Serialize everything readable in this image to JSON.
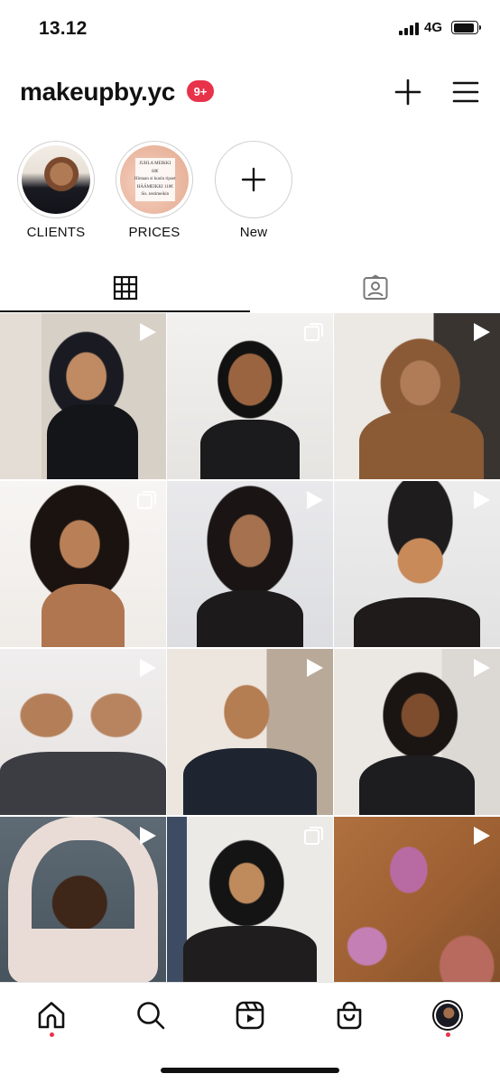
{
  "status": {
    "time": "13.12",
    "network": "4G",
    "battery_level": 0.9
  },
  "profile": {
    "username": "makeupby.yc",
    "notification_badge": "9+"
  },
  "highlights": [
    {
      "label": "CLIENTS",
      "image": "client-portrait"
    },
    {
      "label": "PRICES",
      "image": "price-list",
      "card_lines": [
        "JUHLA MEIKKI",
        "60€",
        "Hintaan si kuulu ripset",
        "HÄÄMEIKKI 110€",
        "Sis. testimeikin"
      ]
    },
    {
      "label": "New",
      "icon": "plus-icon"
    }
  ],
  "tabs": [
    {
      "name": "grid",
      "icon": "grid-icon",
      "selected": true
    },
    {
      "name": "tagged",
      "icon": "tagged-icon",
      "selected": false
    }
  ],
  "posts": [
    {
      "type": "reel",
      "subject": "makeup look in black hijab"
    },
    {
      "type": "carousel",
      "subject": "glam makeup with slicked ponytail"
    },
    {
      "type": "reel",
      "subject": "makeup look in brown hijab"
    },
    {
      "type": "carousel",
      "subject": "yellow eyeshadow look with curls"
    },
    {
      "type": "reel",
      "subject": "soft glam with long hair"
    },
    {
      "type": "reel",
      "subject": "makeup look with black head wrap"
    },
    {
      "type": "reel",
      "subject": "two client glam looks"
    },
    {
      "type": "reel",
      "subject": "makeup look in navy hijab"
    },
    {
      "type": "reel",
      "subject": "makeup look with braids"
    },
    {
      "type": "reel",
      "subject": "makeup look in light pink hijab"
    },
    {
      "type": "carousel",
      "subject": "makeup look in black hijab and leather jacket"
    },
    {
      "type": "reel",
      "subject": "purple eyeshadow close-up"
    }
  ],
  "bottom_nav": [
    {
      "name": "home",
      "icon": "home-icon",
      "dot": true
    },
    {
      "name": "search",
      "icon": "search-icon",
      "dot": false
    },
    {
      "name": "reels",
      "icon": "reels-icon",
      "dot": false
    },
    {
      "name": "shop",
      "icon": "shop-icon",
      "dot": false
    },
    {
      "name": "profile",
      "icon": "profile-avatar",
      "dot": true
    }
  ],
  "colors": {
    "badge_red": "#e8324a",
    "text": "#111111",
    "divider": "#e6e6e6"
  }
}
